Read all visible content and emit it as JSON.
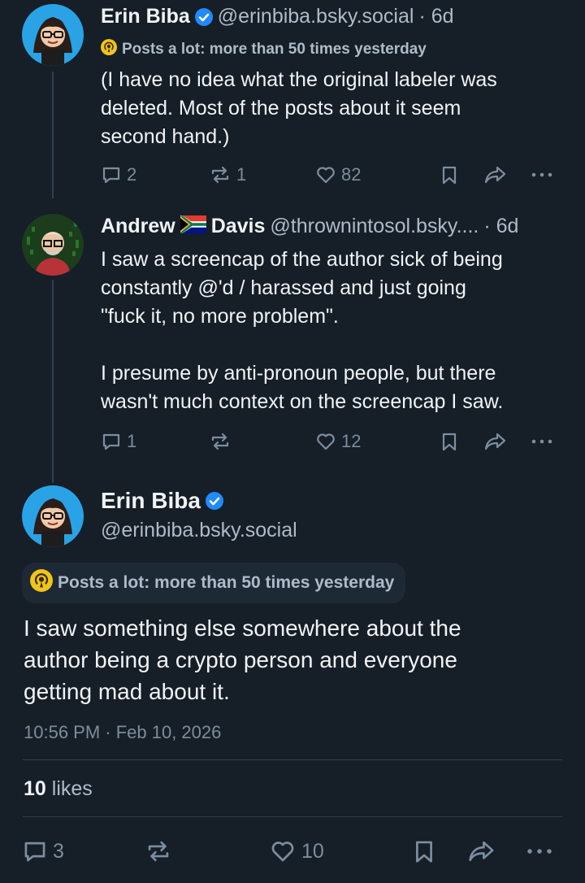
{
  "colors": {
    "background": "#161e27",
    "text": "#f1f3f5",
    "muted": "#7b8d9f",
    "accent": "#208bfe",
    "badge": "#f0c419"
  },
  "posts": [
    {
      "author_name": "Erin Biba",
      "handle": "@erinbiba.bsky.social",
      "time": "· 6d",
      "label": "Posts a lot: more than 50 times yesterday",
      "text": "(I have no idea what the original labeler was\ndeleted. Most of the posts about it seem\nsecond hand.)",
      "replies": "2",
      "reposts": "1",
      "likes": "82"
    },
    {
      "author_first": "Andrew",
      "flag": "south-africa-flag",
      "author_last": "Davis",
      "handle": "@thrownintosol.bsky....",
      "time": "· 6d",
      "text": "I saw a screencap of the author sick of being\nconstantly @'d / harassed and just going\n\"fuck it, no more problem\".\n\nI presume by anti-pronoun people, but there\nwasn't much context on the screencap I saw.",
      "replies": "1",
      "reposts": "",
      "likes": "12"
    }
  ],
  "main_post": {
    "author_name": "Erin Biba",
    "handle": "@erinbiba.bsky.social",
    "label": "Posts a lot: more than 50 times yesterday",
    "text": "I saw something else somewhere about the\nauthor being a crypto person and everyone\ngetting mad about it.",
    "timestamp": "10:56 PM · Feb 10, 2026",
    "likes_count": "10",
    "likes_word": "likes",
    "replies": "3",
    "reposts": "",
    "likes": "10"
  }
}
